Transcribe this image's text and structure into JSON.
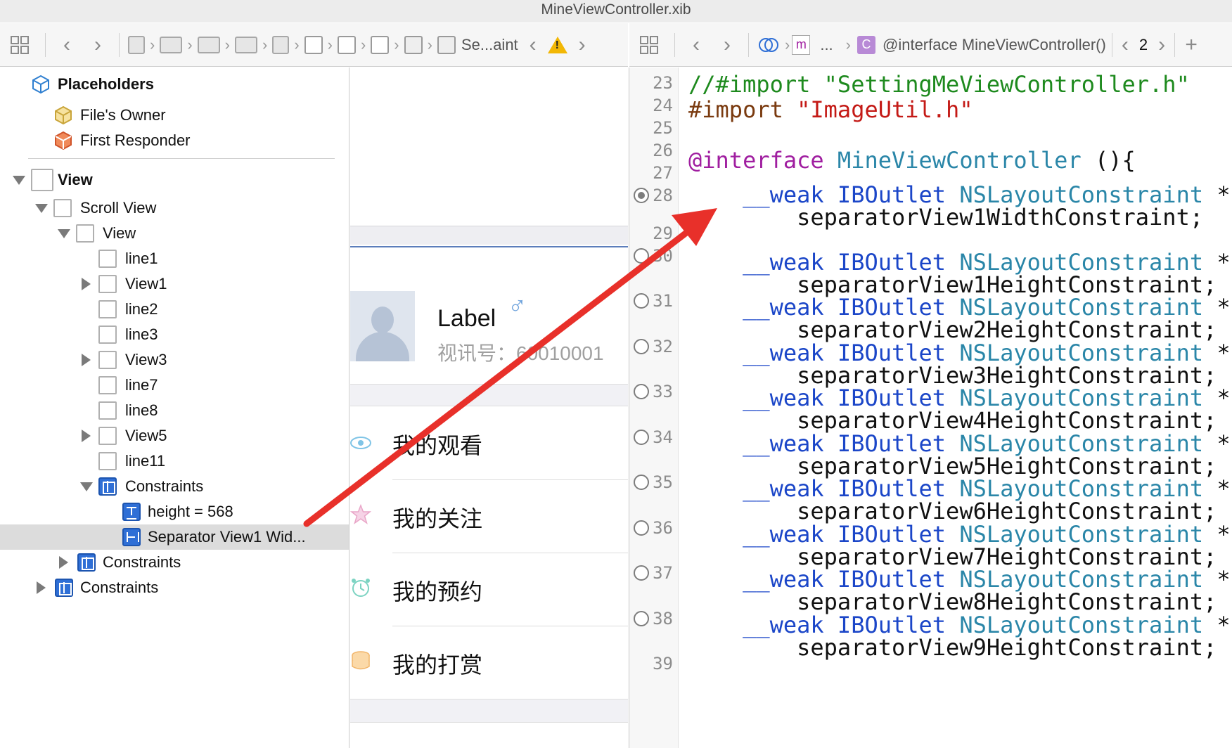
{
  "window": {
    "title": "MineViewController.xib"
  },
  "left_jumpbar": {
    "crumb_label": "Se...aint"
  },
  "right_jumpbar": {
    "m_label": "m",
    "ellipsis": "...",
    "c_label": "C",
    "interface_label": "@interface MineViewController()",
    "count": "2",
    "add_glyph": "+"
  },
  "outline": {
    "placeholders_title": "Placeholders",
    "files_owner": "File's Owner",
    "first_responder": "First Responder",
    "view": "View",
    "scroll_view": "Scroll View",
    "inner_view": "View",
    "line1": "line1",
    "view1": "View1",
    "line2": "line2",
    "line3": "line3",
    "view3": "View3",
    "line7": "line7",
    "line8": "line8",
    "view5": "View5",
    "line11": "line11",
    "constraints_inner": "Constraints",
    "height_constraint": "height = 568",
    "separator_constraint": "Separator View1 Wid...",
    "constraints_scroll": "Constraints",
    "constraints_view": "Constraints"
  },
  "canvas": {
    "profile_label": "Label",
    "gender_glyph": "♂",
    "profile_id": "视讯号：60010001",
    "menu": [
      "我的观看",
      "我的关注",
      "我的预约",
      "我的打赏"
    ]
  },
  "code": {
    "line_numbers": [
      "23",
      "24",
      "25",
      "26",
      "27",
      "28",
      "29",
      "30",
      "31",
      "32",
      "33",
      "34",
      "35",
      "36",
      "37",
      "38",
      "39"
    ],
    "l23": "//#import \"SettingMeViewController.h\"",
    "l24_kw": "#import",
    "l24_str": "\"ImageUtil.h\"",
    "l26_kw": "@interface",
    "l26_type": "MineViewController",
    "l26_rest": " (){",
    "weak": "__weak",
    "iboutlet": "IBOutlet",
    "nslayout": "NSLayoutConstraint",
    "star": " *",
    "names": [
      "separatorView1WidthConstraint;",
      "separatorView1HeightConstraint;",
      "separatorView2HeightConstraint;",
      "separatorView3HeightConstraint;",
      "separatorView4HeightConstraint;",
      "separatorView5HeightConstraint;",
      "separatorView6HeightConstraint;",
      "separatorView7HeightConstraint;",
      "separatorView8HeightConstraint;",
      "separatorView9HeightConstraint;"
    ]
  },
  "colors": {
    "arrow": "#e8302a",
    "keyword": "#a01ea0",
    "string": "#c41a16",
    "comment": "#1e8a1e",
    "type": "#2a86a8"
  }
}
